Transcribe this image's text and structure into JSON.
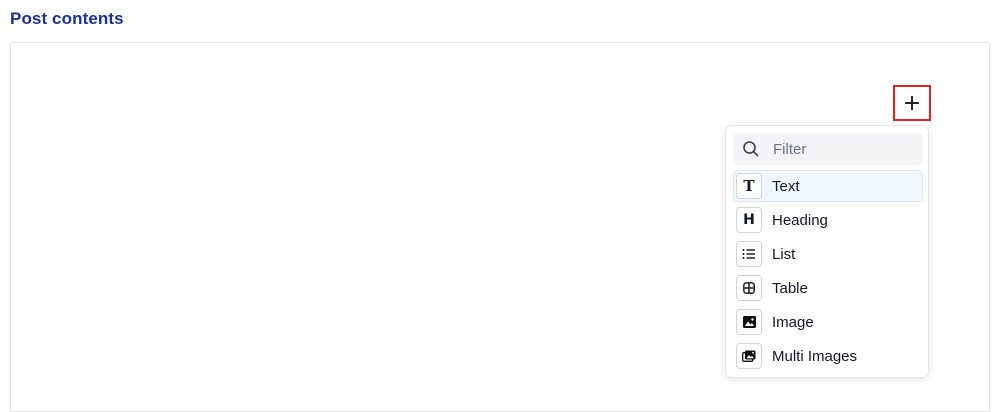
{
  "section": {
    "title": "Post contents"
  },
  "add_button": {
    "symbol": "+"
  },
  "menu": {
    "filter_placeholder": "Filter",
    "items": [
      {
        "label": "Text",
        "icon": "text-icon",
        "glyph": "T"
      },
      {
        "label": "Heading",
        "icon": "heading-icon",
        "glyph": "H"
      },
      {
        "label": "List",
        "icon": "list-icon"
      },
      {
        "label": "Table",
        "icon": "table-icon"
      },
      {
        "label": "Image",
        "icon": "image-icon"
      },
      {
        "label": "Multi Images",
        "icon": "multi-images-icon"
      }
    ]
  },
  "colors": {
    "title": "#1a2fa0",
    "highlight_border": "#e0261b",
    "active_item_bg": "#f0f7ff"
  }
}
